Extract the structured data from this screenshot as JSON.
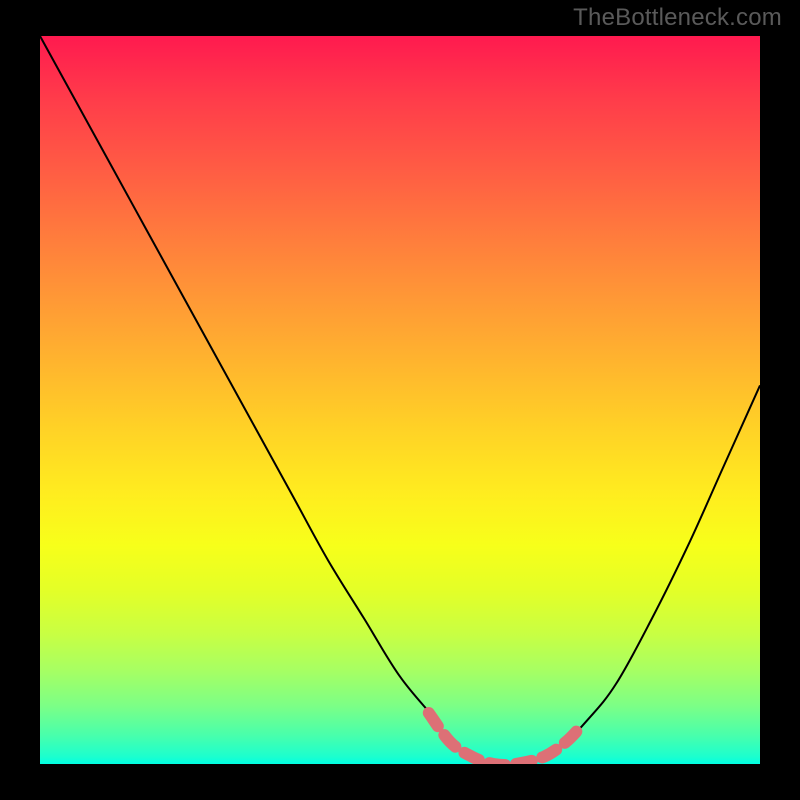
{
  "watermark": "TheBottleneck.com",
  "colors": {
    "background": "#000000",
    "watermark_text": "#5a5a5a",
    "line": "#000000",
    "dashed_highlight": "#dd7076",
    "gradient_top": "#ff1a4f",
    "gradient_bottom": "#00ffe2"
  },
  "chart_data": {
    "type": "line",
    "title": "",
    "xlabel": "",
    "ylabel": "",
    "xlim": [
      0,
      100
    ],
    "ylim": [
      0,
      100
    ],
    "grid": false,
    "legend": false,
    "series": [
      {
        "name": "bottleneck-curve",
        "x": [
          0,
          5,
          10,
          15,
          20,
          25,
          30,
          35,
          40,
          45,
          50,
          55,
          57,
          60,
          63,
          66,
          70,
          73,
          76,
          80,
          85,
          90,
          95,
          100
        ],
        "y": [
          100,
          91,
          82,
          73,
          64,
          55,
          46,
          37,
          28,
          20,
          12,
          6,
          3,
          1,
          0,
          0,
          1,
          3,
          6,
          11,
          20,
          30,
          41,
          52
        ]
      }
    ],
    "annotations": [
      {
        "name": "optimal-range-dashed",
        "style": "dashed",
        "x": [
          54,
          57,
          60,
          63,
          66,
          70,
          73,
          75
        ],
        "y": [
          7,
          3,
          1,
          0,
          0,
          1,
          3,
          5
        ]
      }
    ]
  }
}
